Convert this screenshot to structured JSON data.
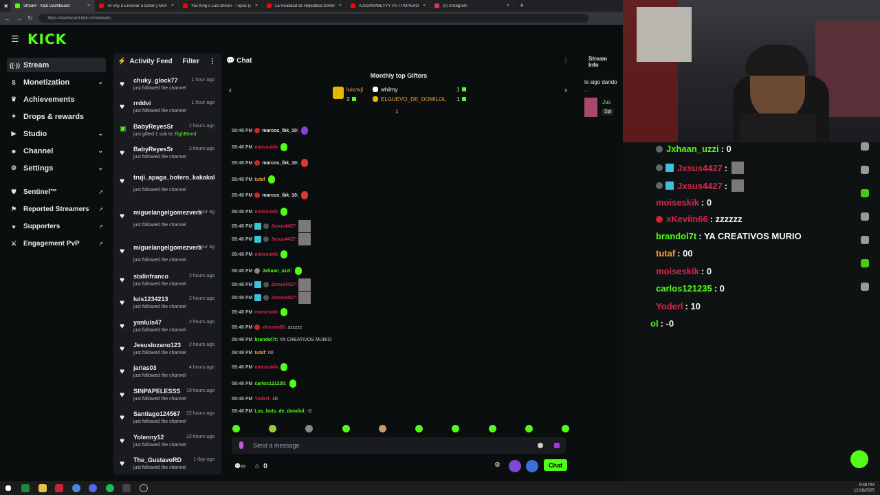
{
  "browser": {
    "tabs": [
      {
        "label": "Stream - Kick Dashboard",
        "color": "#53fc18",
        "active": true
      },
      {
        "label": "Te Voy a Enseñar a Crear y Monet",
        "color": "#ff0000"
      },
      {
        "label": "Yaii King x Luis Brown - Tupac (v",
        "color": "#ff0000"
      },
      {
        "label": "La Realidad de República Domini",
        "color": "#ff0000"
      },
      {
        "label": "AJSOWAWEYYY PUT POPEROLIN",
        "color": "#ff0000"
      },
      {
        "label": "(3) Instagram",
        "color": "#e1306c"
      }
    ],
    "url": "https://dashboard.kick.com/stream"
  },
  "logo": "KICK",
  "nav": {
    "items": [
      {
        "label": "Stream",
        "icon": "broadcast-icon",
        "glyph": "((·))"
      },
      {
        "label": "Monetization",
        "icon": "dollar-icon",
        "glyph": "$",
        "chev": "⌄"
      },
      {
        "label": "Achievements",
        "icon": "trophy-icon",
        "glyph": "♛"
      },
      {
        "label": "Drops & rewards",
        "icon": "gift-icon",
        "glyph": "✦"
      },
      {
        "label": "Studio",
        "icon": "camera-icon",
        "glyph": "▶",
        "chev": "⌄"
      },
      {
        "label": "Channel",
        "icon": "user-icon",
        "glyph": "☻",
        "chev": "⌄"
      },
      {
        "label": "Settings",
        "icon": "gear-icon",
        "glyph": "⚙",
        "chev": "⌄"
      }
    ],
    "ext_items": [
      {
        "label": "Sentinel™",
        "icon": "shield-icon",
        "glyph": "⛊"
      },
      {
        "label": "Reported Streamers",
        "icon": "flag-icon",
        "glyph": "⚑"
      },
      {
        "label": "Supporters",
        "icon": "heart-icon",
        "glyph": "♥"
      },
      {
        "label": "Engagement PvP",
        "icon": "swords-icon",
        "glyph": "⚔"
      }
    ]
  },
  "activity": {
    "title": "Activity Feed",
    "filter_label": "Filter",
    "items": [
      {
        "user": "chuky_glock77",
        "time": "1 hour ago",
        "desc": "just followed the channel"
      },
      {
        "user": "rrddvi",
        "time": "1 hour ago",
        "desc": "just followed the channel"
      },
      {
        "user": "BabyReyesSr",
        "time": "2 hours ago",
        "desc": "just gifted 1 sub to: ",
        "target": "flighBleed",
        "gift": true
      },
      {
        "user": "BabyReyesSr",
        "time": "2 hours ago",
        "desc": "just followed the channel"
      },
      {
        "user": "truji_apaga_botero_kakakak",
        "time": "",
        "desc": "just followed the channel"
      },
      {
        "user": "miguelangelgomezvera",
        "time": "hour ag",
        "desc": "just followed the channel"
      },
      {
        "user": "miguelangelgomezvera",
        "time": "hour ag",
        "desc": "just followed the channel"
      },
      {
        "user": "stalinfranco",
        "time": "2 hours ago",
        "desc": "just followed the channel"
      },
      {
        "user": "luis1234213",
        "time": "2 hours ago",
        "desc": "just followed the channel"
      },
      {
        "user": "yanluis47",
        "time": "2 hours ago",
        "desc": "just followed the channel"
      },
      {
        "user": "Jesuslozano123",
        "time": "2 hours ago",
        "desc": "just followed the channel"
      },
      {
        "user": "jarias03",
        "time": "4 hours ago",
        "desc": "just followed the channel"
      },
      {
        "user": "SINPAPELESSS",
        "time": "19 hours ago",
        "desc": "just followed the channel"
      },
      {
        "user": "Santiago124567",
        "time": "22 hours ago",
        "desc": "just followed the channel"
      },
      {
        "user": "Yolenny12",
        "time": "22 hours ago",
        "desc": "just followed the channel"
      },
      {
        "user": "The_GustavoRD",
        "time": "1 day ago",
        "desc": "just followed the channel"
      }
    ]
  },
  "chat": {
    "title": "Chat",
    "gifters_title": "Monthly top Gifters",
    "gifters": [
      {
        "name": "luixnvjl",
        "count": "3",
        "color": "#e6b800"
      },
      {
        "name": "whilmy",
        "count": "1",
        "color": "#ffffff"
      },
      {
        "name": "ELGUEVO_DE_DOMILOL",
        "count": "1",
        "color": "#e6b800"
      }
    ],
    "messages": [
      {
        "time": "09:48 PM",
        "user": "marcos_lbk_10:",
        "color": "#e8e8e8",
        "dot": "#c82828",
        "msg": "",
        "emote": "#8a3dd8"
      },
      {
        "time": "09:48 PM",
        "user": "moiseskik",
        "color": "#d7264a",
        "msg": "",
        "emote": "#53fc18"
      },
      {
        "time": "09:48 PM",
        "user": "marcos_lbk_10:",
        "color": "#e8e8e8",
        "dot": "#c82828",
        "msg": "",
        "emote": "#d83a3a"
      },
      {
        "time": "09:48 PM",
        "user": "tutaf",
        "color": "#f0a040",
        "msg": "",
        "emote": "#53fc18"
      },
      {
        "time": "09:48 PM",
        "user": "marcos_lbk_10:",
        "color": "#e8e8e8",
        "dot": "#c82828",
        "msg": "",
        "emote": "#d83a3a"
      },
      {
        "time": "09:48 PM",
        "user": "moiseskik",
        "color": "#d7264a",
        "msg": "",
        "emote": "#53fc18"
      },
      {
        "time": "09:48 PM",
        "user": "Jxsus4427:",
        "color": "#d7264a",
        "badge": true,
        "msg": "",
        "face": true
      },
      {
        "time": "09:48 PM",
        "user": "Jxsus4427:",
        "color": "#d7264a",
        "badge": true,
        "msg": "",
        "face": true
      },
      {
        "time": "09:48 PM",
        "user": "moiseskik",
        "color": "#d7264a",
        "msg": "",
        "emote": "#53fc18"
      },
      {
        "time": "09:48 PM",
        "user": "Jxhaan_uzzi:",
        "color": "#53fc18",
        "dot": "#888888",
        "msg": "",
        "emote": "#53fc18"
      },
      {
        "time": "09:48 PM",
        "user": "Jxsus4427:",
        "color": "#d7264a",
        "badge": true,
        "msg": "",
        "face": true
      },
      {
        "time": "09:48 PM",
        "user": "Jxsus4427:",
        "color": "#d7264a",
        "badge": true,
        "msg": "",
        "face": true
      },
      {
        "time": "09:48 PM",
        "user": "moiseskik",
        "color": "#d7264a",
        "msg": "",
        "emote": "#53fc18"
      },
      {
        "time": "09:48 PM",
        "user": "xKeviin66:",
        "color": "#d7264a",
        "dot": "#c82828",
        "msg": "zzzzzz"
      },
      {
        "time": "09:48 PM",
        "user": "brandol7t:",
        "color": "#53fc18",
        "msg": "YA CREATIVOS MURIO"
      },
      {
        "time": "09:48 PM",
        "user": "tutaf:",
        "color": "#f0a040",
        "msg": "00"
      },
      {
        "time": "09:48 PM",
        "user": "moiseskik",
        "color": "#d7264a",
        "msg": "",
        "emote": "#53fc18"
      },
      {
        "time": "09:48 PM",
        "user": "carlos121235:",
        "color": "#53fc18",
        "msg": "",
        "emote": "#53fc18"
      },
      {
        "time": "09:48 PM",
        "user": "Yoderl:",
        "color": "#d7264a",
        "msg": "10"
      },
      {
        "time": "09:48 PM",
        "user": "Los_bots_de_domilol:",
        "color": "#53fc18",
        "msg": "-0"
      }
    ],
    "input_placeholder": "Send a message",
    "viewer_count": "0",
    "send_label": "Chat"
  },
  "stream_info": {
    "title": "Stream Info",
    "text": "le sigo dando ...",
    "user": "Jus",
    "tag": "Spi"
  },
  "overlay": {
    "lines": [
      {
        "user": "Jxhaan_uzzi",
        "color": "#53fc18",
        "msg": ": 0",
        "dot": "#666"
      },
      {
        "user": "Jxsus4427",
        "color": "#d7264a",
        "msg": ":",
        "badge": true,
        "face": true
      },
      {
        "user": "Jxsus4427",
        "color": "#d7264a",
        "msg": ":",
        "badge": true,
        "face": true
      },
      {
        "user": "moiseskik",
        "color": "#d7264a",
        "msg": ": 0"
      },
      {
        "user": "xKeviin66",
        "color": "#d7264a",
        "msg": ": zzzzzz",
        "dot": "#c82828"
      },
      {
        "user": "brandol7t",
        "color": "#53fc18",
        "msg": ": YA CREATIVOS MURIO"
      },
      {
        "user": "tutaf",
        "color": "#f0a040",
        "msg": ": 00"
      },
      {
        "user": "moiseskik",
        "color": "#d7264a",
        "msg": ": 0"
      },
      {
        "user": "carlos121235",
        "color": "#53fc18",
        "msg": ": 0"
      },
      {
        "user": "Yoderl",
        "color": "#d7264a",
        "msg": ": 10"
      },
      {
        "user": "ol",
        "color": "#53fc18",
        "msg": ": -0"
      }
    ]
  },
  "taskbar": {
    "time": "9:48 PM",
    "date": "12/18/2025"
  }
}
